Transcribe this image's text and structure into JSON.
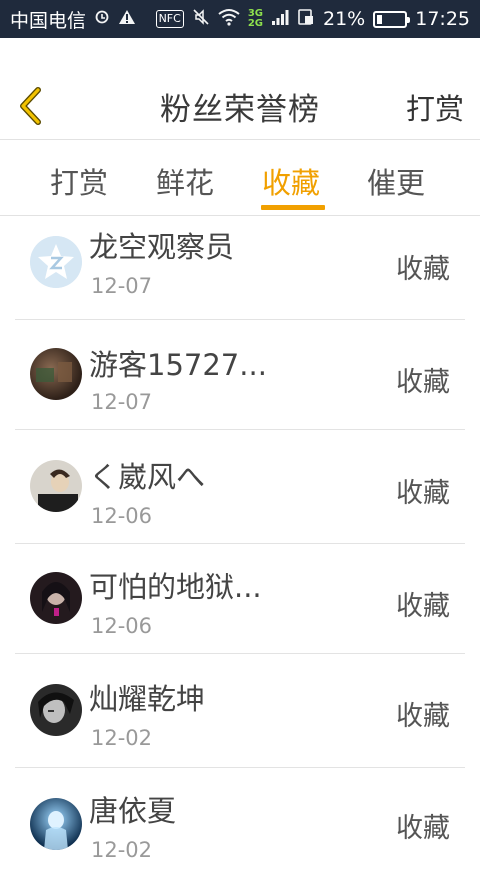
{
  "status_bar": {
    "carrier": "中国电信",
    "nfc": "NFC",
    "net_top": "3G",
    "net_bottom": "2G",
    "battery": "21%",
    "battery_level": 0.21,
    "time": "17:25"
  },
  "header": {
    "title": "粉丝荣誉榜",
    "action": "打赏"
  },
  "tabs": [
    {
      "label": "打赏",
      "active": false
    },
    {
      "label": "鲜花",
      "active": false
    },
    {
      "label": "收藏",
      "active": true
    },
    {
      "label": "催更",
      "active": false
    }
  ],
  "list": [
    {
      "name": "龙空观察员",
      "date": "12-07",
      "action": "收藏",
      "avatar": "logo-avatar"
    },
    {
      "name": "游客15727...",
      "date": "12-07",
      "action": "收藏",
      "avatar": "photo-avatar"
    },
    {
      "name": "く崴风へ",
      "date": "12-06",
      "action": "收藏",
      "avatar": "photo-avatar"
    },
    {
      "name": "可怕的地狱...",
      "date": "12-06",
      "action": "收藏",
      "avatar": "photo-avatar"
    },
    {
      "name": "灿耀乾坤",
      "date": "12-02",
      "action": "收藏",
      "avatar": "photo-avatar"
    },
    {
      "name": "唐依夏",
      "date": "12-02",
      "action": "收藏",
      "avatar": "photo-avatar"
    }
  ],
  "colors": {
    "accent": "#f1a000",
    "status_bar_bg": "#1f2a3c"
  }
}
